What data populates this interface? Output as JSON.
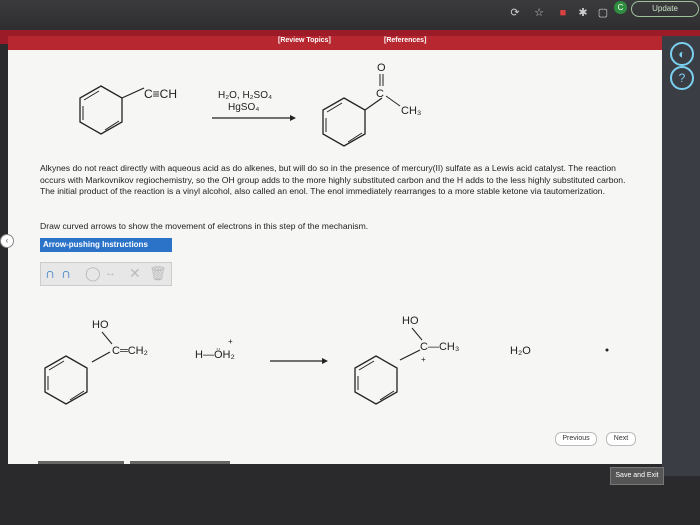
{
  "browser": {
    "update_label": "Update",
    "avatar_letter": "C"
  },
  "tabs": {
    "review": "[Review Topics]",
    "references": "[References]"
  },
  "reaction": {
    "reagents_top": "H₂O, H₂SO₄",
    "reagents_bottom": "HgSO₄",
    "alkyne_group": "C≡CH",
    "ketone_o": "O",
    "ketone_c": "C",
    "ketone_ch3": "CH₃"
  },
  "paragraph": "Alkynes do not react directly with aqueous acid as do alkenes, but will do so in the presence of mercury(II) sulfate as a Lewis acid catalyst. The reaction occurs with Markovnikov regiochemistry, so the OH group adds to the more highly substituted carbon and the H adds to the less highly substituted carbon. The initial product of the reaction is a vinyl alcohol, also called an enol. The enol immediately rearranges to a more stable ketone via tautomerization.",
  "instruction": "Draw curved arrows to show the movement of electrons in this step of the mechanism.",
  "arrow_pushing_label": "Arrow-pushing Instructions",
  "mechanism": {
    "ho_left": "HO",
    "c_ch2": "C═CH₂",
    "hydronium": "H—ÖH₂",
    "ho_right": "HO",
    "cation": "C—CH₃",
    "water": "H₂O"
  },
  "nav": {
    "previous": "Previous",
    "next": "Next"
  },
  "save_exit": "Save and Exit"
}
